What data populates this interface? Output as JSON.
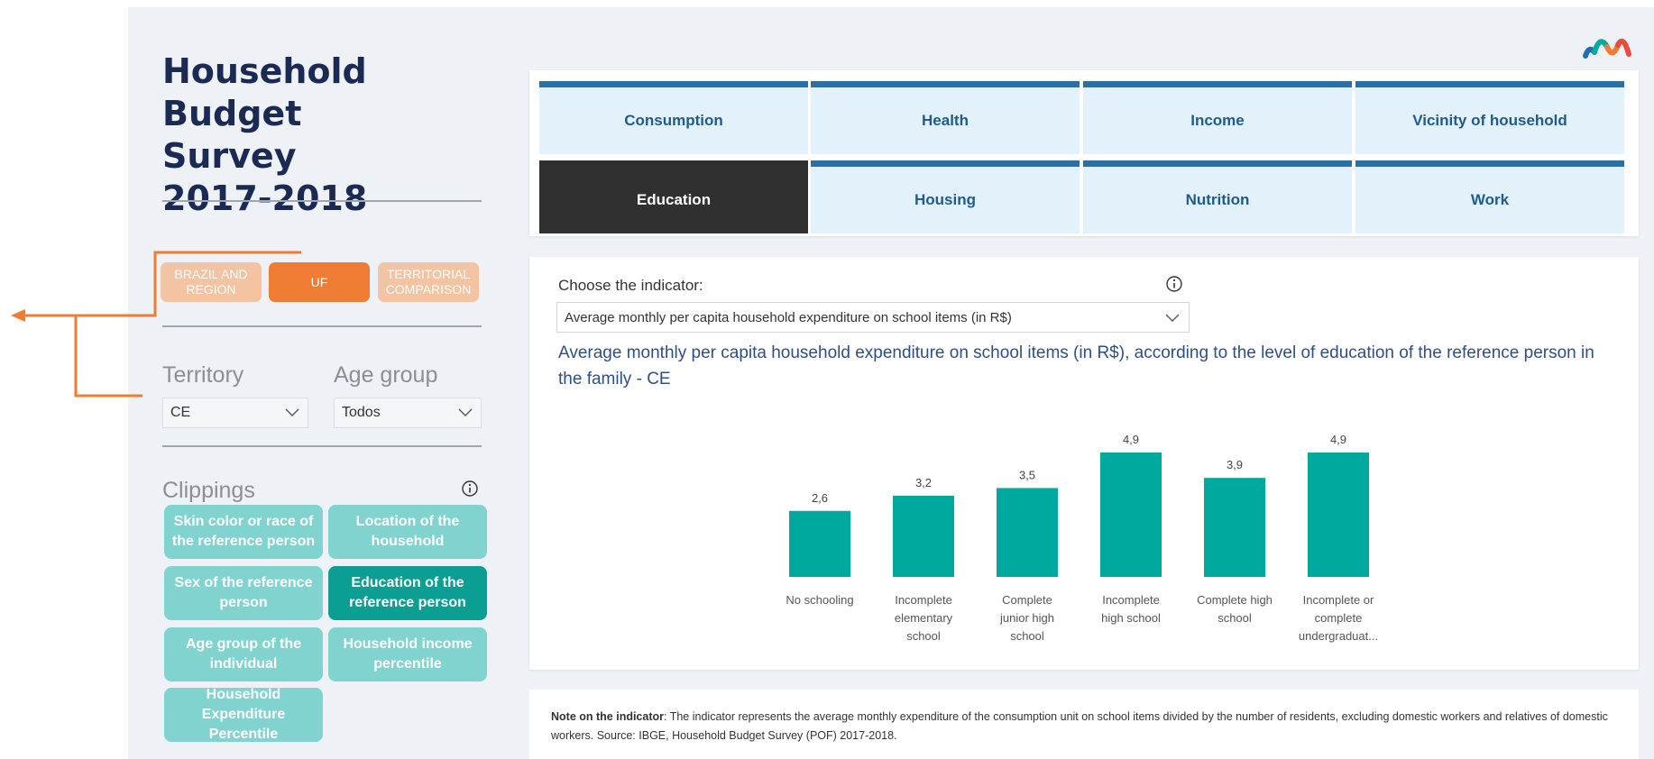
{
  "title_lines": [
    "Household",
    "Budget",
    "Survey",
    "2017-2018"
  ],
  "scope_buttons": [
    {
      "line1": "BRAZIL AND",
      "line2": "REGION"
    },
    {
      "line1": "UF",
      "line2": ""
    },
    {
      "line1": "TERRITORIAL",
      "line2": "COMPARISON"
    }
  ],
  "filters": {
    "territory_label": "Territory",
    "territory_value": "CE",
    "age_label": "Age group",
    "age_value": "Todos"
  },
  "clippings": {
    "label": "Clippings",
    "items": [
      "Skin color or race of the reference person",
      "Location of the household",
      "Sex of the reference person",
      "Education of the reference person",
      "Age group of the individual",
      "Household income percentile",
      "Household Expenditure Percentile"
    ],
    "active_index": 3
  },
  "tabs": [
    "Consumption",
    "Health",
    "Income",
    "Vicinity of household",
    "Education",
    "Housing",
    "Nutrition",
    "Work"
  ],
  "active_tab": "Education",
  "indicator": {
    "choose_label": "Choose the indicator:",
    "selected": "Average monthly per capita household expenditure on school items (in R$)"
  },
  "chart_data": {
    "type": "bar",
    "title": "Average monthly per capita household expenditure on school items (in R$), according to the level of education of the reference person in the family - CE",
    "categories": [
      [
        "No schooling"
      ],
      [
        "Incomplete",
        "elementary",
        "school"
      ],
      [
        "Complete",
        "junior high",
        "school"
      ],
      [
        "Incomplete",
        "high school"
      ],
      [
        "Complete high",
        "school"
      ],
      [
        "Incomplete or",
        "complete",
        "undergraduat..."
      ]
    ],
    "values": [
      2.6,
      3.2,
      3.5,
      4.9,
      3.9,
      4.9
    ],
    "value_labels": [
      "2,6",
      "3,2",
      "3,5",
      "4,9",
      "3,9",
      "4,9"
    ],
    "ylim": [
      0,
      4.9
    ],
    "bar_color": "#00a99d",
    "grid": false
  },
  "note": {
    "label": "Note on the indicator",
    "text": ": The indicator represents the average monthly expenditure of the consumption unit on school items divided by the number of residents, excluding domestic workers and relatives of domestic workers. Source: IBGE, Household Budget Survey (POF) 2017-2018."
  },
  "colors": {
    "accent_orange": "#ee7d33",
    "teal": "#00a99d",
    "tab_blue": "#2f6ea1",
    "title_navy": "#1b2a52"
  }
}
